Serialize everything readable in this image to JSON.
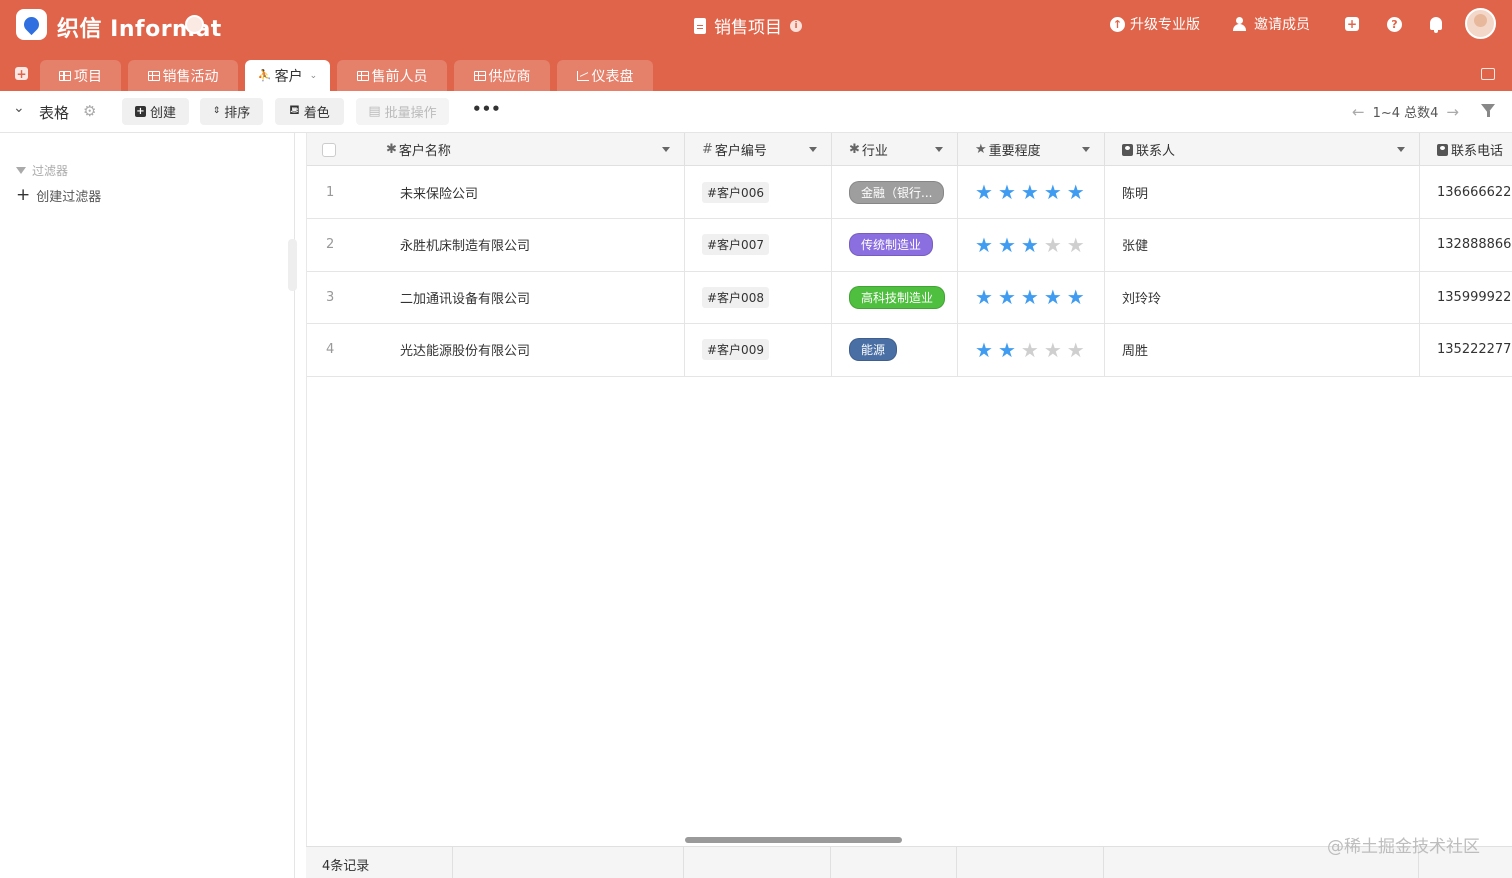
{
  "app": {
    "brand": "织信 Informat",
    "doc_title": "销售项目",
    "actions": {
      "upgrade": "升级专业版",
      "invite": "邀请成员"
    }
  },
  "tabs": [
    {
      "label": "项目",
      "icon": "grid-icon",
      "active": false
    },
    {
      "label": "销售活动",
      "icon": "grid-icon",
      "active": false
    },
    {
      "label": "客户",
      "icon": "person-icon",
      "active": true
    },
    {
      "label": "售前人员",
      "icon": "grid-icon",
      "active": false
    },
    {
      "label": "供应商",
      "icon": "grid-icon",
      "active": false
    },
    {
      "label": "仪表盘",
      "icon": "chart-icon",
      "active": false
    }
  ],
  "toolbar": {
    "view_label": "表格",
    "create": "创建",
    "sort": "排序",
    "color": "着色",
    "batch": "批量操作",
    "pager": "1~4 总数4"
  },
  "filter_panel": {
    "title": "过滤器",
    "create": "创建过滤器"
  },
  "table": {
    "columns": [
      {
        "label": "客户名称",
        "prefix": "✱"
      },
      {
        "label": "客户编号",
        "prefix": "#"
      },
      {
        "label": "行业",
        "prefix": "✱"
      },
      {
        "label": "重要程度",
        "prefix": "★"
      },
      {
        "label": "联系人",
        "prefix": "box"
      },
      {
        "label": "联系电话",
        "prefix": "box"
      }
    ],
    "rows": [
      {
        "num": "1",
        "name": "未来保险公司",
        "code": "#客户006",
        "industry": "金融（银行...",
        "industry_color": "#9e9e9e",
        "rating": 5,
        "contact": "陈明",
        "phone": "136666622"
      },
      {
        "num": "2",
        "name": "永胜机床制造有限公司",
        "code": "#客户007",
        "industry": "传统制造业",
        "industry_color": "#8b6ee0",
        "rating": 3,
        "contact": "张健",
        "phone": "132888866"
      },
      {
        "num": "3",
        "name": "二加通讯设备有限公司",
        "code": "#客户008",
        "industry": "高科技制造业",
        "industry_color": "#4fbf3f",
        "rating": 5,
        "contact": "刘玲玲",
        "phone": "135999922"
      },
      {
        "num": "4",
        "name": "光达能源股份有限公司",
        "code": "#客户009",
        "industry": "能源",
        "industry_color": "#4a6fa5",
        "rating": 2,
        "contact": "周胜",
        "phone": "135222277"
      }
    ]
  },
  "footer": {
    "count": "4条记录"
  },
  "watermark": "@稀土掘金技术社区",
  "colors": {
    "brand": "#e0644a",
    "star_on": "#3f9cf0",
    "star_off": "#cfcfcf"
  }
}
